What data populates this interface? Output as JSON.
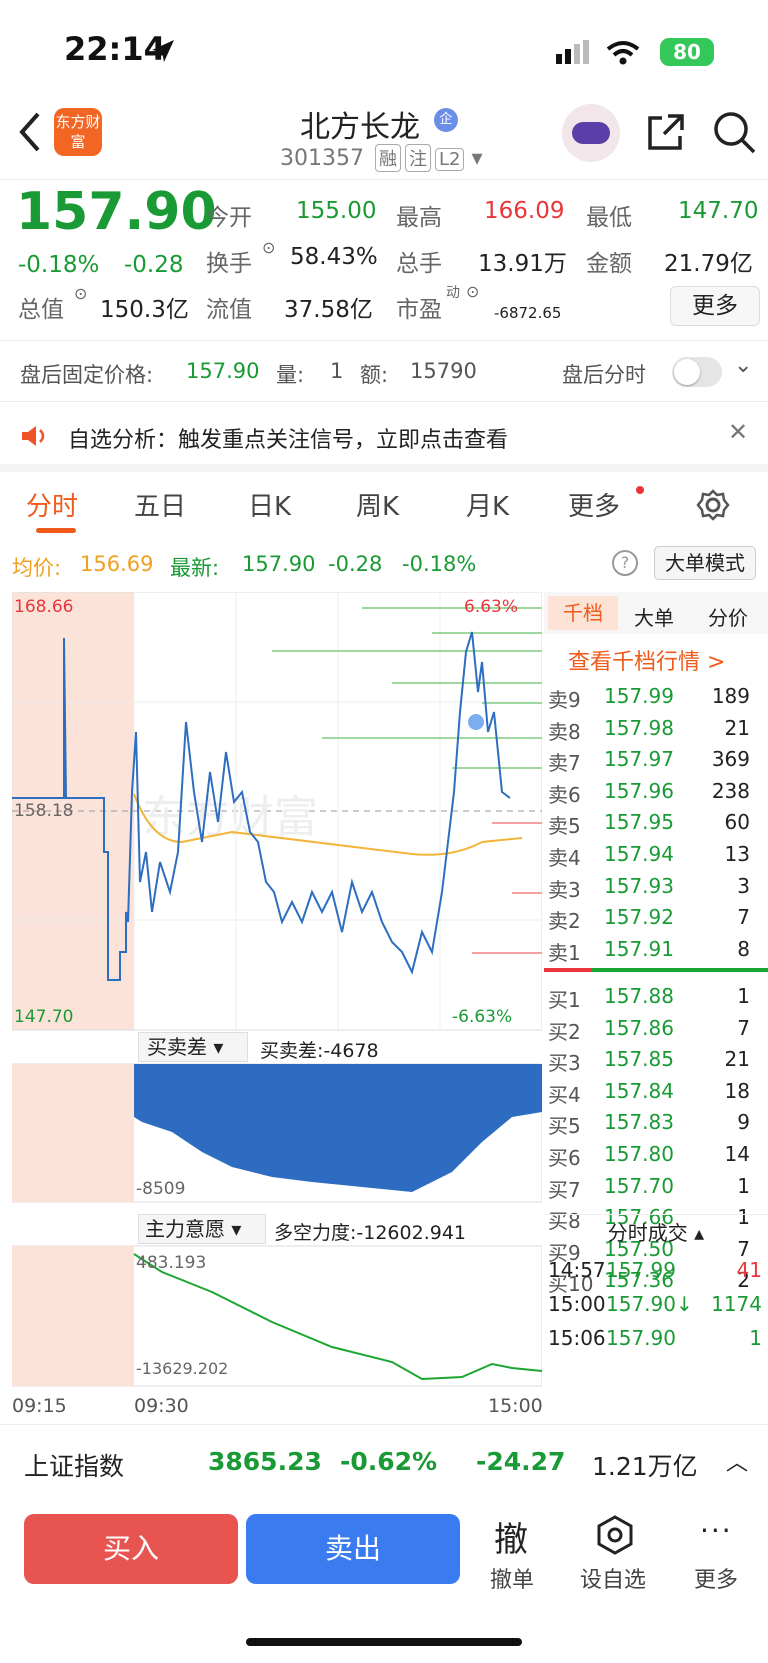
{
  "status": {
    "time": "22:14",
    "battery": "80"
  },
  "header": {
    "title": "北方长龙",
    "code": "301357",
    "tags": [
      "融",
      "注",
      "L2"
    ],
    "logo": "东方财富"
  },
  "quote": {
    "price": "157.90",
    "change_pct": "-0.18%",
    "change": "-0.28",
    "open_label": "今开",
    "open": "155.00",
    "high_label": "最高",
    "high": "166.09",
    "low_label": "最低",
    "low": "147.70",
    "turnover_label": "换手",
    "turnover": "58.43%",
    "volume_label": "总手",
    "volume": "13.91万",
    "amount_label": "金额",
    "amount": "21.79亿",
    "mcap_label": "总值",
    "mcap": "150.3亿",
    "float_label": "流值",
    "float": "37.58亿",
    "pe_label": "市盈",
    "pe_sup": "动",
    "pe": "-6872.65",
    "more": "更多"
  },
  "after": {
    "label": "盘后固定价格:",
    "price": "157.90",
    "qty_label": "量:",
    "qty": "1",
    "amt_label": "额:",
    "amt": "15790",
    "toggle_label": "盘后分时"
  },
  "notice": {
    "text": "自选分析：触发重点关注信号，立即点击查看"
  },
  "tabs": [
    "分时",
    "五日",
    "日K",
    "周K",
    "月K",
    "更多"
  ],
  "legend": {
    "avg_label": "均价:",
    "avg": "156.69",
    "latest_label": "最新:",
    "latest": "157.90",
    "chg": "-0.28",
    "pct": "-0.18%",
    "mode": "大单模式"
  },
  "chart": {
    "top": "168.66",
    "mid": "158.18",
    "bottom": "147.70",
    "pct_top": "6.63%",
    "pct_bot": "-6.63%",
    "watermark": "东方财富",
    "sub1_label": "买卖差",
    "sub1_value": "买卖差:-4678",
    "sub1_min": "-8509",
    "sub2_label": "主力意愿",
    "sub2_value": "多空力度:-12602.941",
    "sub2_max": "483.193",
    "sub2_min": "-13629.202",
    "times": [
      "09:15",
      "09:30",
      "15:00"
    ]
  },
  "book": {
    "tabs": [
      "千档",
      "大单",
      "分价"
    ],
    "link": "查看千档行情 >",
    "asks": [
      [
        "卖9",
        "157.99",
        "189"
      ],
      [
        "卖8",
        "157.98",
        "21"
      ],
      [
        "卖7",
        "157.97",
        "369"
      ],
      [
        "卖6",
        "157.96",
        "238"
      ],
      [
        "卖5",
        "157.95",
        "60"
      ],
      [
        "卖4",
        "157.94",
        "13"
      ],
      [
        "卖3",
        "157.93",
        "3"
      ],
      [
        "卖2",
        "157.92",
        "7"
      ],
      [
        "卖1",
        "157.91",
        "8"
      ]
    ],
    "bids": [
      [
        "买1",
        "157.88",
        "1"
      ],
      [
        "买2",
        "157.86",
        "7"
      ],
      [
        "买3",
        "157.85",
        "21"
      ],
      [
        "买4",
        "157.84",
        "18"
      ],
      [
        "买5",
        "157.83",
        "9"
      ],
      [
        "买6",
        "157.80",
        "14"
      ],
      [
        "买7",
        "157.70",
        "1"
      ],
      [
        "买8",
        "157.66",
        "1"
      ],
      [
        "买9",
        "157.50",
        "7"
      ],
      [
        "买10",
        "157.36",
        "2"
      ]
    ],
    "trades_label": "分时成交",
    "trades": [
      [
        "14:57",
        "157.99",
        "41"
      ],
      [
        "15:00",
        "157.90↓",
        "1174"
      ],
      [
        "15:06",
        "157.90",
        "1"
      ]
    ]
  },
  "index": {
    "name": "上证指数",
    "value": "3865.23",
    "pct": "-0.62%",
    "chg": "-24.27",
    "amount": "1.21万亿"
  },
  "actions": {
    "buy": "买入",
    "sell": "卖出",
    "cancel_icon": "撤",
    "cancel": "撤单",
    "watch": "设自选",
    "more": "更多"
  }
}
